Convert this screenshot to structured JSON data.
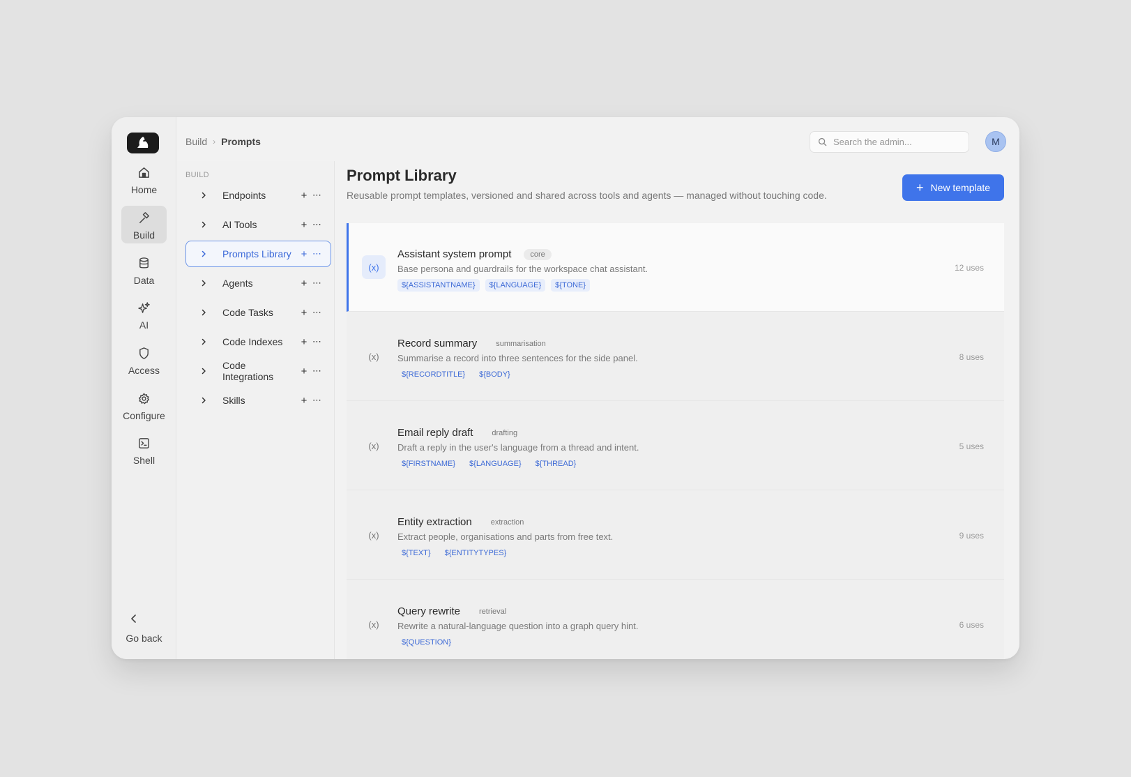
{
  "breadcrumb": {
    "parent": "Build",
    "current": "Prompts"
  },
  "search": {
    "placeholder": "Search the admin..."
  },
  "avatar": {
    "initial": "M"
  },
  "rail": {
    "items": [
      {
        "label": "Home",
        "icon": "home-icon"
      },
      {
        "label": "Build",
        "icon": "hammer-icon",
        "active": true
      },
      {
        "label": "Data",
        "icon": "database-icon"
      },
      {
        "label": "AI",
        "icon": "sparkles-icon"
      },
      {
        "label": "Access",
        "icon": "shield-icon"
      },
      {
        "label": "Configure",
        "icon": "gear-icon"
      },
      {
        "label": "Shell",
        "icon": "terminal-icon"
      }
    ],
    "go_back": "Go back"
  },
  "tree": {
    "heading": "BUILD",
    "items": [
      {
        "label": "Endpoints"
      },
      {
        "label": "AI Tools"
      },
      {
        "label": "Prompts Library",
        "active": true
      },
      {
        "label": "Agents"
      },
      {
        "label": "Code Tasks"
      },
      {
        "label": "Code Indexes"
      },
      {
        "label": "Code Integrations"
      },
      {
        "label": "Skills"
      }
    ]
  },
  "main": {
    "title": "Prompt Library",
    "subtitle": "Reusable prompt templates, versioned and shared across tools and agents — managed without touching code.",
    "new_button": "New template",
    "templates": [
      {
        "title": "Assistant system prompt",
        "tag": "core",
        "description": "Base persona and guardrails for the workspace chat assistant.",
        "vars": [
          "${ASSISTANTNAME}",
          "${LANGUAGE}",
          "${TONE}"
        ],
        "uses": "12 uses",
        "icon": "(x)"
      },
      {
        "title": "Record summary",
        "tag": "summarisation",
        "description": "Summarise a record into three sentences for the side panel.",
        "vars": [
          "${RECORDTITLE}",
          "${BODY}"
        ],
        "uses": "8 uses",
        "icon": "(x)"
      },
      {
        "title": "Email reply draft",
        "tag": "drafting",
        "description": "Draft a reply in the user's language from a thread and intent.",
        "vars": [
          "${FIRSTNAME}",
          "${LANGUAGE}",
          "${THREAD}"
        ],
        "uses": "5 uses",
        "icon": "(x)"
      },
      {
        "title": "Entity extraction",
        "tag": "extraction",
        "description": "Extract people, organisations and parts from free text.",
        "vars": [
          "${TEXT}",
          "${ENTITYTYPES}"
        ],
        "uses": "9 uses",
        "icon": "(x)"
      },
      {
        "title": "Query rewrite",
        "tag": "retrieval",
        "description": "Rewrite a natural-language question into a graph query hint.",
        "vars": [
          "${QUESTION}"
        ],
        "uses": "6 uses",
        "icon": "(x)"
      }
    ]
  },
  "colors": {
    "accent": "#3f74ea",
    "background": "#e3e3e3",
    "window": "#f2f2f2"
  }
}
